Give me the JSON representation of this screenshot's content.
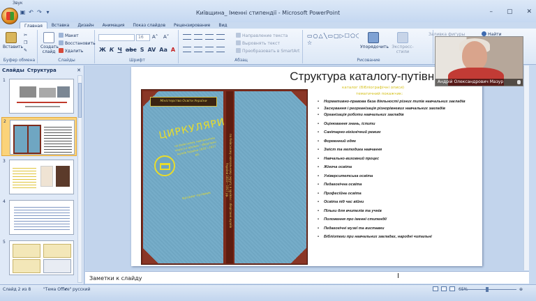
{
  "titlebar": {
    "zoom_label": "Звук",
    "title": "Київщина_ Іменні стипендії - Microsoft PowerPoint",
    "min": "–",
    "max": "▢",
    "close": "✕"
  },
  "tabs": [
    "Главная",
    "Вставка",
    "Дизайн",
    "Анимация",
    "Показ слайдов",
    "Рецензирование",
    "Вид"
  ],
  "ribbon": {
    "paste": "Вставить",
    "new_slide": "Создать слайд",
    "layout": "Макет",
    "reset": "Восстановить",
    "delete": "Удалить",
    "font_size": "16",
    "text_direction": "Направление текста",
    "align_text": "Выровнять текст",
    "smartart": "Преобразовать в SmartArt",
    "arrange": "Упорядочить",
    "quick_styles": "Экспресс-стили",
    "shape_fill": "Заливка фигуры",
    "find": "Найти",
    "groups": {
      "clipboard": "Буфер обмена",
      "slides": "Слайды",
      "font": "Шрифт",
      "paragraph": "Абзац",
      "drawing": "Рисование"
    }
  },
  "left_panel": {
    "tab_slides": "Слайды",
    "tab_outline": "Структура",
    "close": "✕",
    "slide_numbers": [
      "1",
      "2",
      "3",
      "4",
      "5"
    ]
  },
  "slide": {
    "title": "Структура каталогу-путівника:",
    "book": {
      "label": "Міністерство Освіти України",
      "title": "ЦИРКУЛЯРИ",
      "lines": "по Київському навчальному округу в архівах і зберіганні музеїв України 1833—1917 рр.",
      "subtitle": "Каталог-путівник"
    },
    "headings": [
      "каталог (бібліографічні описи)",
      "тематичний покажчик:"
    ],
    "items": [
      "Нормативно-правова база діяльності різних типів навчальних закладів",
      "Заснування і реорганізація різнорівневих навчальних закладів",
      "Організація роботи навчальних закладів",
      "Оцінювання знань, іспити",
      "Санітарно-гігієнічний режим",
      "Форменний одяг",
      "Зміст та методика навчання",
      "Навчально-виховний процес",
      "Жіноча освіта",
      "Університетська освіта",
      "Педагогічна освіта",
      "Професійна освіта",
      "Освіта під час війни",
      "Пільги для вчителів та учнів",
      "Положення про іменні стипендії",
      "Педагогічні музеї та виставки",
      "Бібліотеки при навчальних закладах, народні читальні"
    ]
  },
  "video": {
    "name": "Андрій Олександрович Мазур"
  },
  "notes": {
    "placeholder": "Заметки к слайду"
  },
  "status": {
    "slide": "Слайд 2 из 8",
    "theme": "\"Тема Office\"",
    "language": "русский",
    "zoom": "65%"
  }
}
